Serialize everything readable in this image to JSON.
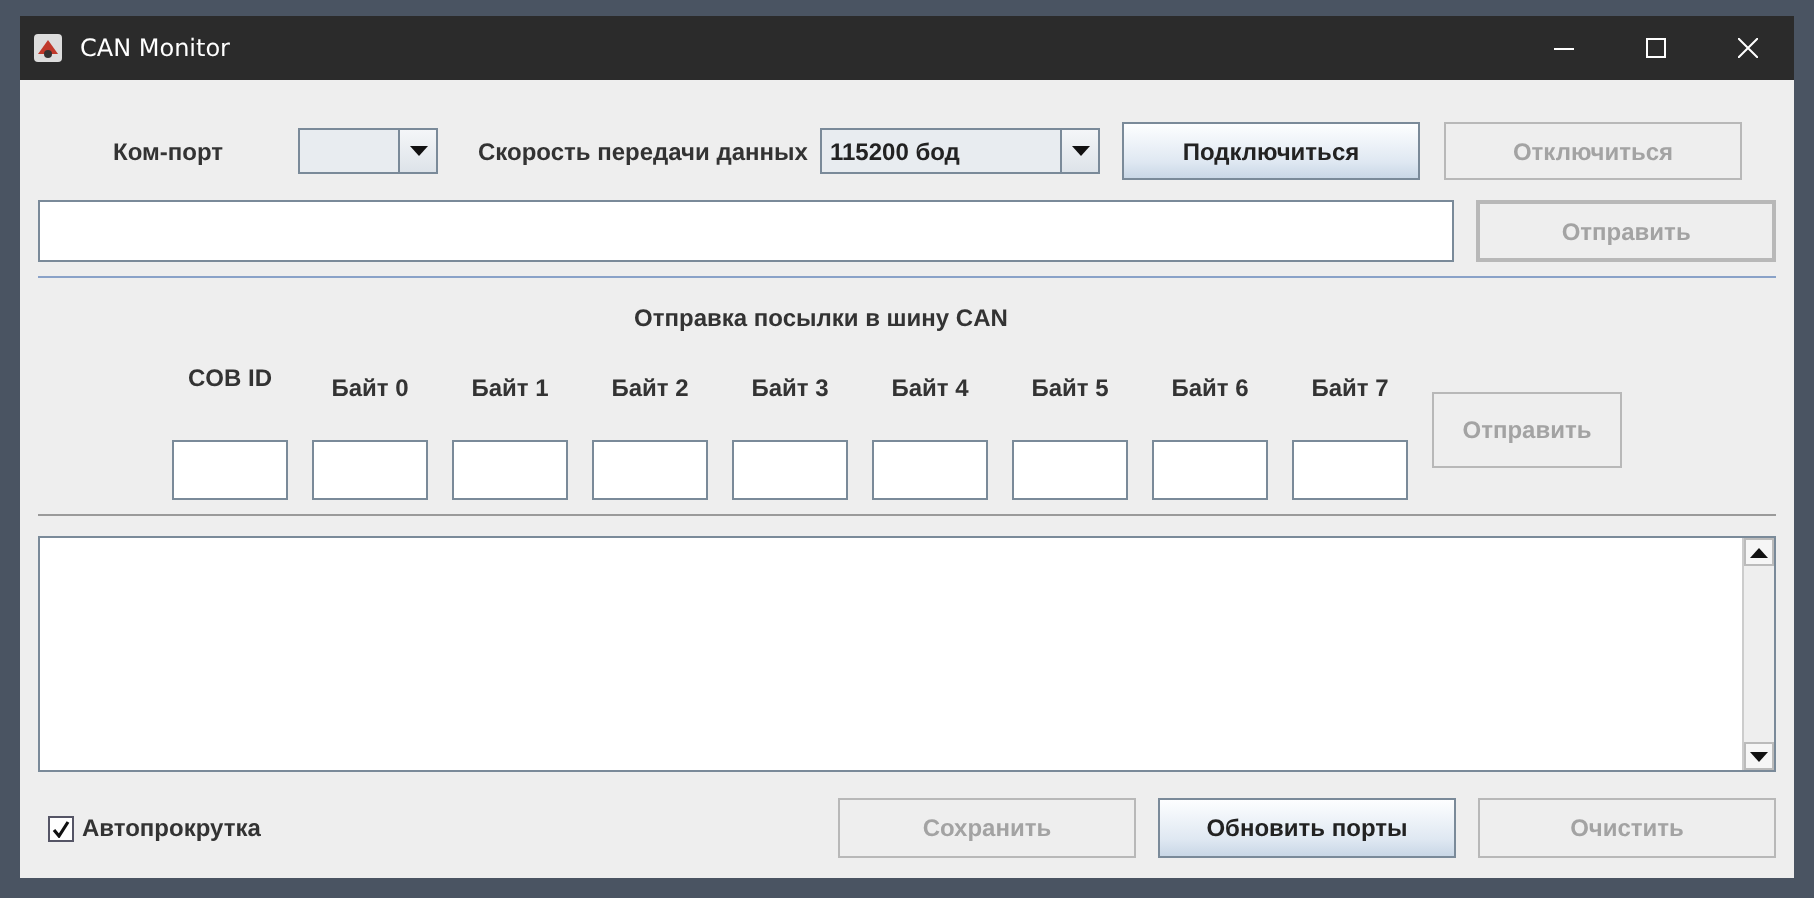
{
  "window": {
    "title": "CAN Monitor"
  },
  "connection": {
    "port_label": "Ком-порт",
    "baud_label": "Скорость передачи данных",
    "baud_value": "115200 бод",
    "buttons": [
      {
        "label": "Подключиться",
        "disabled": false
      },
      {
        "label": "Отключиться",
        "disabled": true
      }
    ]
  },
  "command": {
    "send_button": {
      "label": "Отправить",
      "disabled": true
    }
  },
  "can_frame": {
    "title": "Отправка посылки в шину CAN",
    "fields": [
      {
        "label": "COB ID"
      },
      {
        "label": "Байт 0"
      },
      {
        "label": "Байт 1"
      },
      {
        "label": "Байт 2"
      },
      {
        "label": "Байт 3"
      },
      {
        "label": "Байт 4"
      },
      {
        "label": "Байт 5"
      },
      {
        "label": "Байт 6"
      },
      {
        "label": "Байт 7"
      }
    ],
    "send_button": {
      "label": "Отправить",
      "disabled": true
    }
  },
  "autoscroll": {
    "label": "Автопрокрутка",
    "checked": true
  },
  "bottom_buttons": [
    {
      "label": "Сохранить",
      "disabled": true
    },
    {
      "label": "Обновить порты",
      "disabled": false
    },
    {
      "label": "Очистить",
      "disabled": true
    }
  ]
}
